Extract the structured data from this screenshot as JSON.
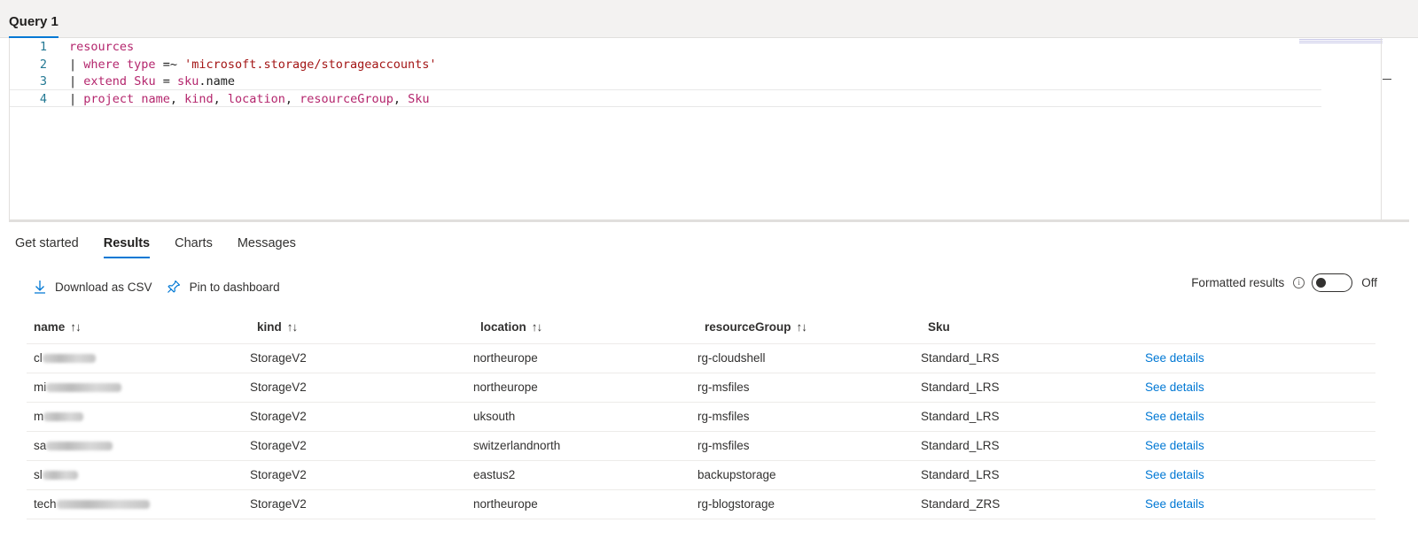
{
  "query_tab": {
    "label": "Query 1"
  },
  "editor": {
    "lines": [
      {
        "num": "1",
        "tokens": [
          {
            "t": "resources",
            "c": "kw"
          }
        ]
      },
      {
        "num": "2",
        "tokens": [
          {
            "t": "| ",
            "c": "pipe"
          },
          {
            "t": "where",
            "c": "kw"
          },
          {
            "t": " ",
            "c": "pl"
          },
          {
            "t": "type",
            "c": "kw"
          },
          {
            "t": " =~ ",
            "c": "pl"
          },
          {
            "t": "'microsoft.storage/storageaccounts'",
            "c": "str"
          }
        ]
      },
      {
        "num": "3",
        "tokens": [
          {
            "t": "| ",
            "c": "pipe"
          },
          {
            "t": "extend",
            "c": "kw"
          },
          {
            "t": " ",
            "c": "pl"
          },
          {
            "t": "Sku",
            "c": "kw"
          },
          {
            "t": " = ",
            "c": "pl"
          },
          {
            "t": "sku",
            "c": "kw"
          },
          {
            "t": ".name",
            "c": "pl"
          }
        ]
      },
      {
        "num": "4",
        "tokens": [
          {
            "t": "| ",
            "c": "pipe"
          },
          {
            "t": "project",
            "c": "kw"
          },
          {
            "t": " ",
            "c": "pl"
          },
          {
            "t": "name",
            "c": "kw"
          },
          {
            "t": ", ",
            "c": "pl"
          },
          {
            "t": "kind",
            "c": "kw"
          },
          {
            "t": ", ",
            "c": "pl"
          },
          {
            "t": "location",
            "c": "kw"
          },
          {
            "t": ", ",
            "c": "pl"
          },
          {
            "t": "resourceGroup",
            "c": "kw"
          },
          {
            "t": ", ",
            "c": "pl"
          },
          {
            "t": "Sku",
            "c": "kw"
          }
        ]
      }
    ]
  },
  "tabs": [
    {
      "label": "Get started",
      "active": false
    },
    {
      "label": "Results",
      "active": true
    },
    {
      "label": "Charts",
      "active": false
    },
    {
      "label": "Messages",
      "active": false
    }
  ],
  "toolbar": {
    "download_label": "Download as CSV",
    "pin_label": "Pin to dashboard",
    "formatted_label": "Formatted results",
    "toggle_state": "Off"
  },
  "table": {
    "columns": [
      "name",
      "kind",
      "location",
      "resourceGroup",
      "Sku"
    ],
    "sort_glyph": "↑↓",
    "rows": [
      {
        "name_prefix": "cl",
        "kind": "StorageV2",
        "location": "northeurope",
        "resourceGroup": "rg-cloudshell",
        "sku": "Standard_LRS",
        "action": "See details"
      },
      {
        "name_prefix": "mi",
        "kind": "StorageV2",
        "location": "northeurope",
        "resourceGroup": "rg-msfiles",
        "sku": "Standard_LRS",
        "action": "See details"
      },
      {
        "name_prefix": "m",
        "kind": "StorageV2",
        "location": "uksouth",
        "resourceGroup": "rg-msfiles",
        "sku": "Standard_LRS",
        "action": "See details"
      },
      {
        "name_prefix": "sa",
        "kind": "StorageV2",
        "location": "switzerlandnorth",
        "resourceGroup": "rg-msfiles",
        "sku": "Standard_LRS",
        "action": "See details"
      },
      {
        "name_prefix": "sl",
        "kind": "StorageV2",
        "location": "eastus2",
        "resourceGroup": "backupstorage",
        "sku": "Standard_LRS",
        "action": "See details"
      },
      {
        "name_prefix": "tech",
        "kind": "StorageV2",
        "location": "northeurope",
        "resourceGroup": "rg-blogstorage",
        "sku": "Standard_ZRS",
        "action": "See details"
      }
    ]
  },
  "colors": {
    "accent": "#0078d4",
    "keyword": "#b4266d",
    "string": "#a31515",
    "line_number": "#237893"
  }
}
